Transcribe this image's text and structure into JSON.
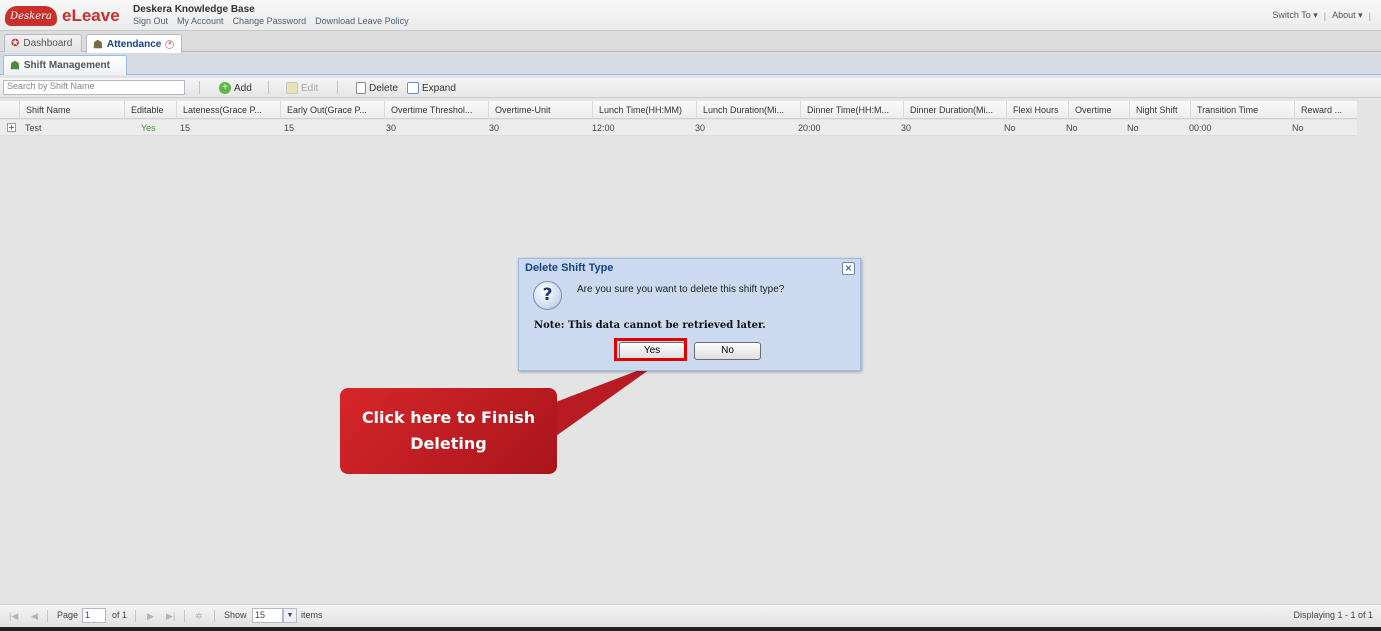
{
  "header": {
    "logo_cloud": "Deskera",
    "logo_app": "eLeave",
    "kb_title": "Deskera Knowledge Base",
    "links": [
      "Sign Out",
      "My Account",
      "Change Password",
      "Download Leave Policy"
    ],
    "switch_to": "Switch To ▾",
    "about": "About ▾"
  },
  "tabs": {
    "dashboard": "Dashboard",
    "attendance": "Attendance",
    "sub": "Shift Management"
  },
  "toolbar": {
    "search_placeholder": "Search by Shift Name",
    "add": "Add",
    "edit": "Edit",
    "delete": "Delete",
    "expand": "Expand"
  },
  "grid": {
    "columns": [
      "Shift Name",
      "Editable",
      "Lateness(Grace P...",
      "Early Out(Grace P...",
      "Overtime Threshol...",
      "Overtime-Unit",
      "Lunch Time(HH:MM)",
      "Lunch Duration(Mi...",
      "Dinner Time(HH:M...",
      "Dinner Duration(Mi...",
      "Flexi Hours",
      "Overtime",
      "Night Shift",
      "Transition Time",
      "Reward ..."
    ],
    "rows": [
      [
        "Test",
        "Yes",
        "15",
        "15",
        "30",
        "30",
        "12:00",
        "30",
        "20:00",
        "30",
        "No",
        "No",
        "No",
        "00:00",
        "No"
      ]
    ]
  },
  "dialog": {
    "title": "Delete Shift Type",
    "message": "Are you sure you want to delete this shift type?",
    "note": "Note: This data cannot be retrieved later.",
    "yes": "Yes",
    "no": "No"
  },
  "callout": {
    "text": "Click here to Finish Deleting"
  },
  "pager": {
    "page_label": "Page",
    "page_value": "1",
    "of_label": "of 1",
    "show_label": "Show",
    "show_value": "15",
    "items_label": "items",
    "displaying": "Displaying 1 - 1 of 1"
  },
  "colors": {
    "accent_red": "#c9302c",
    "title_blue": "#15428b",
    "dialog_bg": "#cbdaee"
  }
}
